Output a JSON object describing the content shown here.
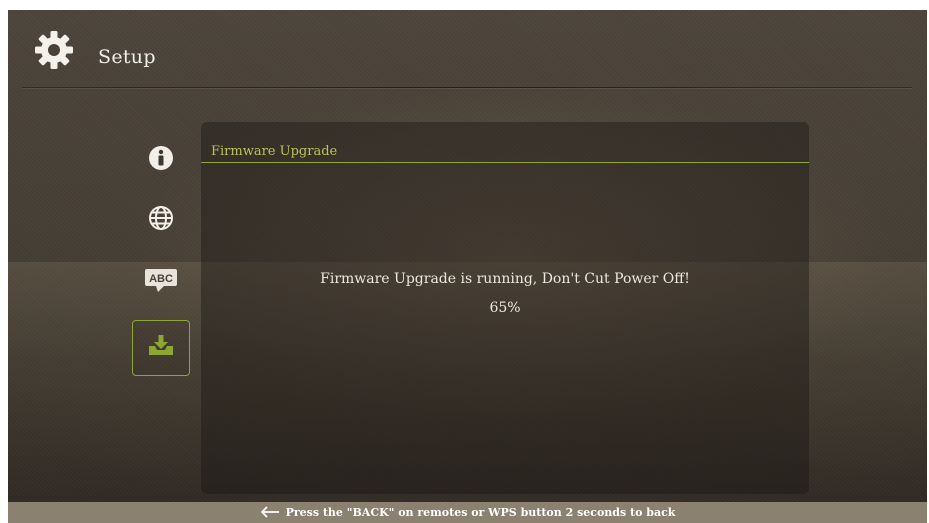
{
  "header": {
    "title": "Setup",
    "icon": "gear-icon"
  },
  "sidebar": {
    "items": [
      {
        "name": "info",
        "icon": "info-icon",
        "active": false
      },
      {
        "name": "network",
        "icon": "globe-icon",
        "active": false
      },
      {
        "name": "language",
        "icon": "abc-icon",
        "icon_text": "ABC",
        "active": false
      },
      {
        "name": "firmware",
        "icon": "download-tray-icon",
        "active": true
      }
    ]
  },
  "panel": {
    "title": "Firmware Upgrade",
    "message": "Firmware Upgrade is running, Don't Cut Power Off!",
    "progress_text": "65%",
    "progress_value": 65
  },
  "footer": {
    "icon": "left-arrow-icon",
    "hint": "Press the \"BACK\" on remotes or WPS button 2 seconds to back"
  },
  "colors": {
    "accent": "#8ea634",
    "title_accent": "#b7c45a",
    "footer_bar": "#8a8170",
    "text": "#ece8df"
  }
}
